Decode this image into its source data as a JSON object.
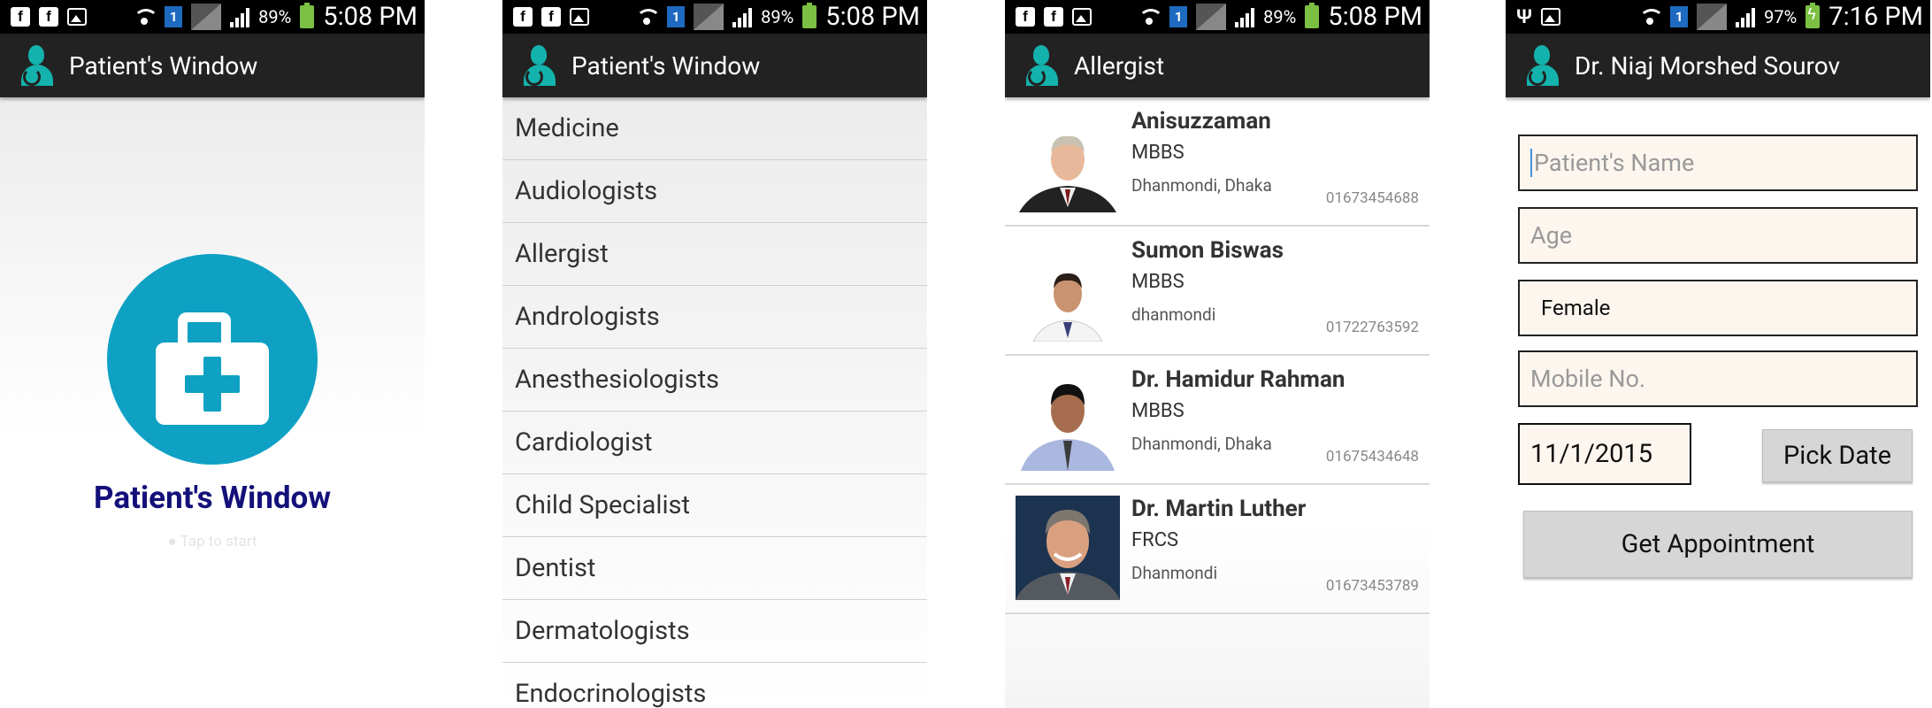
{
  "status": {
    "s1": {
      "battery": "89%",
      "sim": "1",
      "time": "5:08 PM"
    },
    "s2": {
      "battery": "89%",
      "sim": "1",
      "time": "5:08 PM"
    },
    "s3": {
      "battery": "89%",
      "sim": "1",
      "time": "5:08 PM"
    },
    "s4": {
      "battery": "97%",
      "sim": "1",
      "time": "7:16 PM"
    }
  },
  "splash": {
    "action_title": "Patient's Window",
    "title": "Patient's Window",
    "tap": "Tap to start"
  },
  "categories": {
    "action_title": "Patient's Window",
    "items": [
      "Medicine",
      "Audiologists",
      "Allergist",
      "Andrologists",
      "Anesthesiologists",
      "Cardiologist",
      "Child Specialist",
      "Dentist",
      "Dermatologists",
      "Endocrinologists"
    ]
  },
  "doctors": {
    "action_title": "Allergist",
    "list": [
      {
        "name": "Anisuzzaman",
        "degree": "MBBS",
        "area": "Dhanmondi, Dhaka",
        "phone": "01673454688"
      },
      {
        "name": "Sumon Biswas",
        "degree": "MBBS",
        "area": "dhanmondi",
        "phone": "01722763592"
      },
      {
        "name": "Dr. Hamidur Rahman",
        "degree": "MBBS",
        "area": "Dhanmondi, Dhaka",
        "phone": "01675434648"
      },
      {
        "name": "Dr. Martin Luther",
        "degree": "FRCS",
        "area": "Dhanmondi",
        "phone": "01673453789"
      }
    ]
  },
  "appointment": {
    "action_title": "Dr. Niaj Morshed Sourov",
    "name_placeholder": "Patient's Name",
    "age_placeholder": "Age",
    "gender_value": "Female",
    "mobile_placeholder": "Mobile No.",
    "date_value": "11/1/2015",
    "pick_date_label": "Pick Date",
    "get_appointment_label": "Get Appointment"
  },
  "colors": {
    "accent": "#0ea1c4",
    "app_icon": "#14b2ad",
    "title_text": "#14107a",
    "action_bar": "#222222"
  }
}
